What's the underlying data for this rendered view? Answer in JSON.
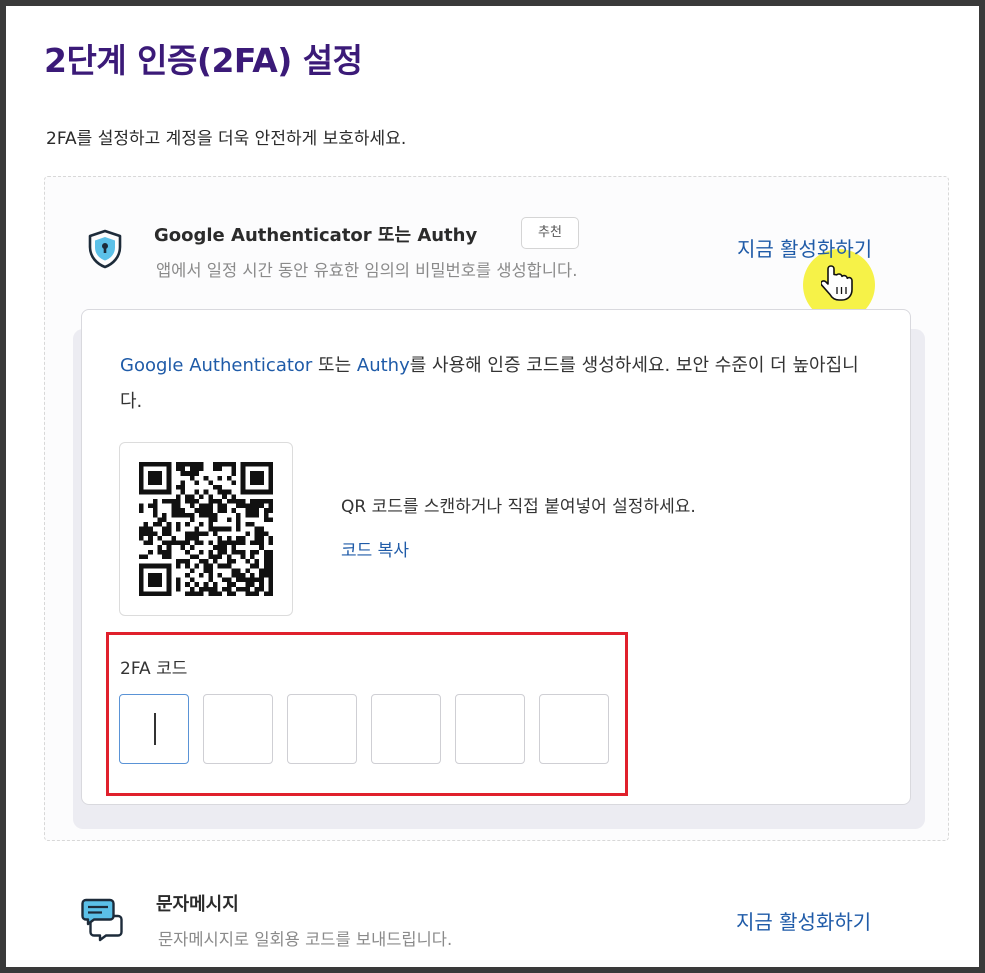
{
  "page": {
    "title": "2단계 인증(2FA) 설정",
    "subtitle": "2FA를 설정하고 계정을 더욱 안전하게 보호하세요."
  },
  "methods": [
    {
      "icon": "shield-icon",
      "title": "Google Authenticator 또는 Authy",
      "badge": "추천",
      "description": "앱에서 일정 시간 동안 유효한 임의의 비밀번호를 생성합니다.",
      "action": "지금 활성화하기"
    },
    {
      "icon": "chat-bubbles-icon",
      "title": "문자메시지",
      "description": "문자메시지로 일회용 코드를 보내드립니다.",
      "action": "지금 활성화하기"
    }
  ],
  "setup": {
    "desc_link1": "Google Authenticator",
    "desc_text1": " 또는 ",
    "desc_link2": "Authy",
    "desc_text2": "를 사용해 인증 코드를 생성하세요. 보안 수준이 더 높아집니다.",
    "scan_text": "QR 코드를 스캔하거나 직접 붙여넣어 설정하세요.",
    "copy_link": "코드 복사",
    "code_label": "2FA 코드",
    "code_digits": [
      "",
      "",
      "",
      "",
      "",
      ""
    ]
  },
  "colors": {
    "title": "#3b1a78",
    "link": "#1f5ba8",
    "highlight_border": "#e0202c",
    "cursor_highlight": "#f5f028"
  }
}
